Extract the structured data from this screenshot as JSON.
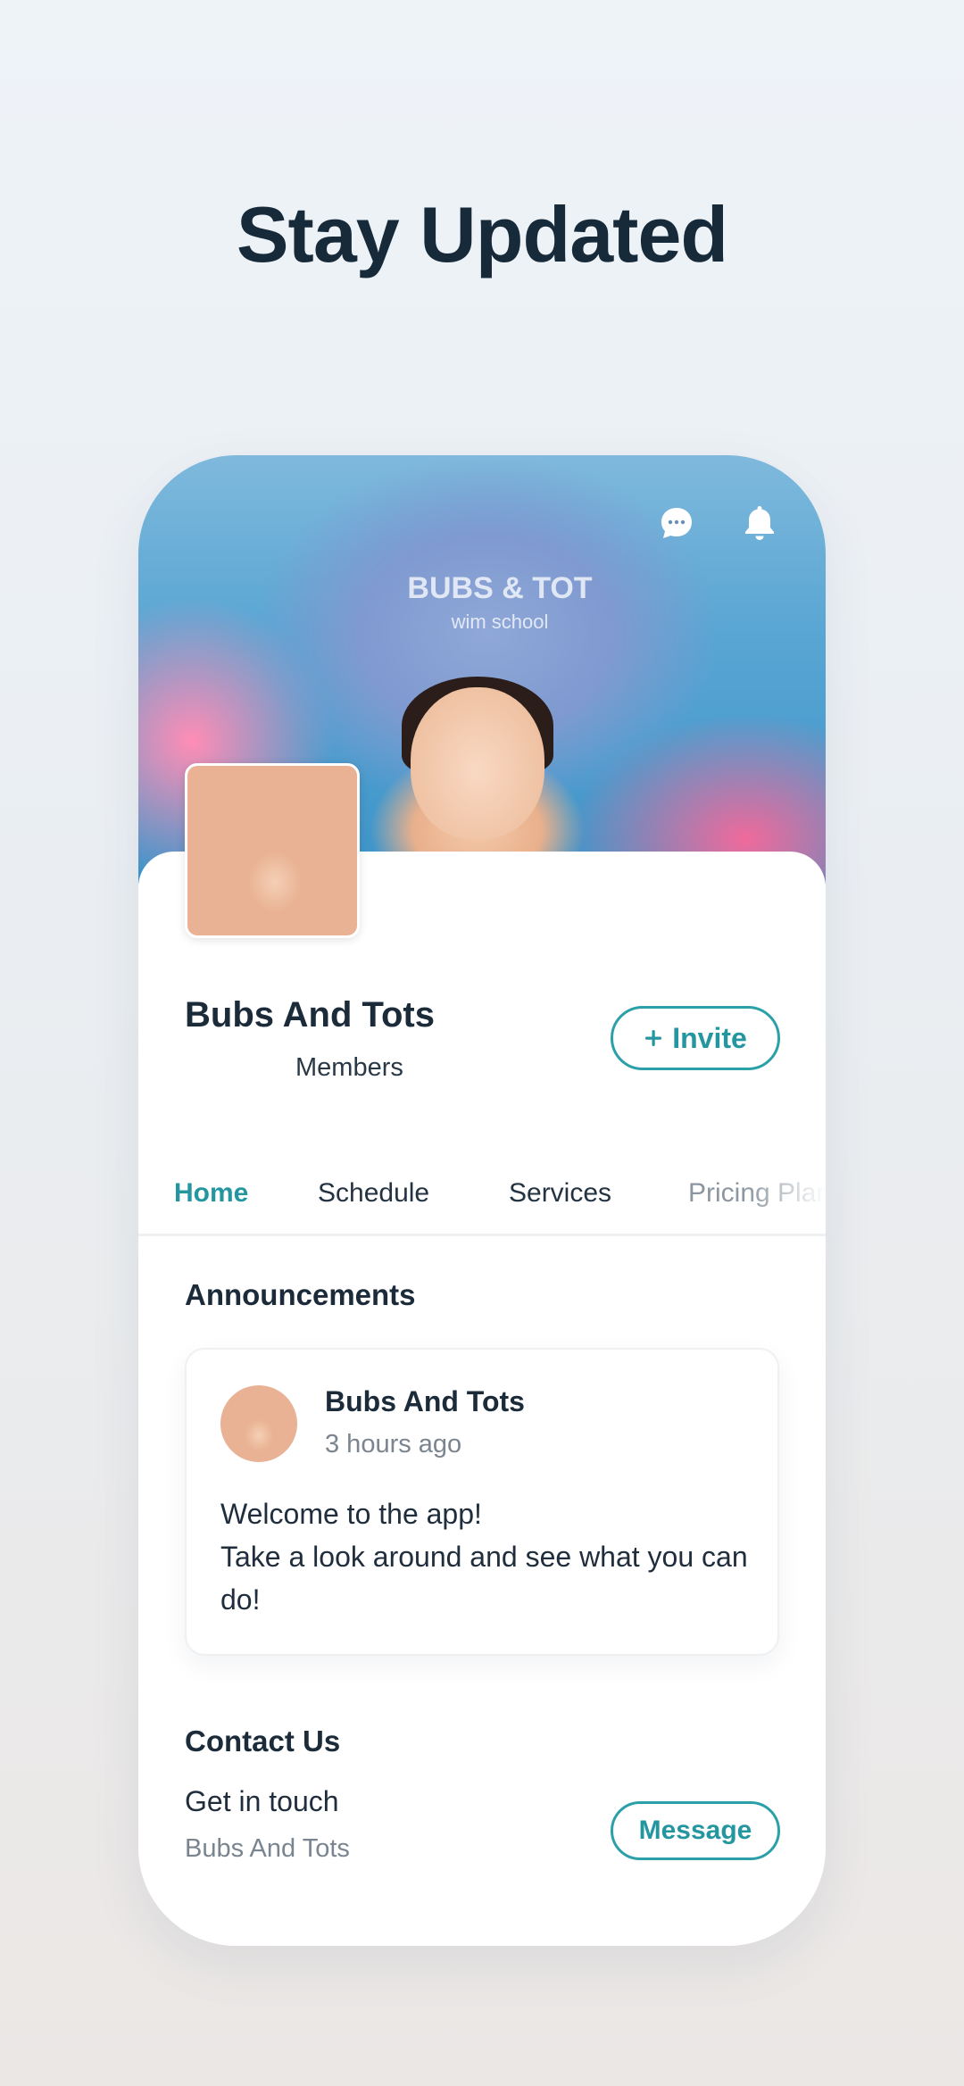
{
  "headline": "Stay Updated",
  "profile": {
    "name": "Bubs And Tots",
    "subtitle": "Members",
    "invite_label": "Invite",
    "cover_shirt_text": "BUBS & TOT",
    "cover_shirt_sub": "wim school"
  },
  "tabs": [
    {
      "label": "Home",
      "active": true
    },
    {
      "label": "Schedule",
      "active": false
    },
    {
      "label": "Services",
      "active": false
    },
    {
      "label": "Pricing Plar",
      "active": false
    }
  ],
  "announcements": {
    "title": "Announcements",
    "post": {
      "author": "Bubs And Tots",
      "time": "3 hours ago",
      "line1": "Welcome to the app!",
      "line2": "Take a look around and see what you can do!"
    }
  },
  "contact": {
    "title": "Contact Us",
    "line": "Get in touch",
    "sub": "Bubs And Tots",
    "message_label": "Message"
  },
  "icons": {
    "chat": "chat-bubble-icon",
    "bell": "bell-icon",
    "plus": "plus-icon"
  },
  "colors": {
    "accent": "#2ba0a8",
    "text_dark": "#172a3a",
    "muted": "#7a8590"
  }
}
